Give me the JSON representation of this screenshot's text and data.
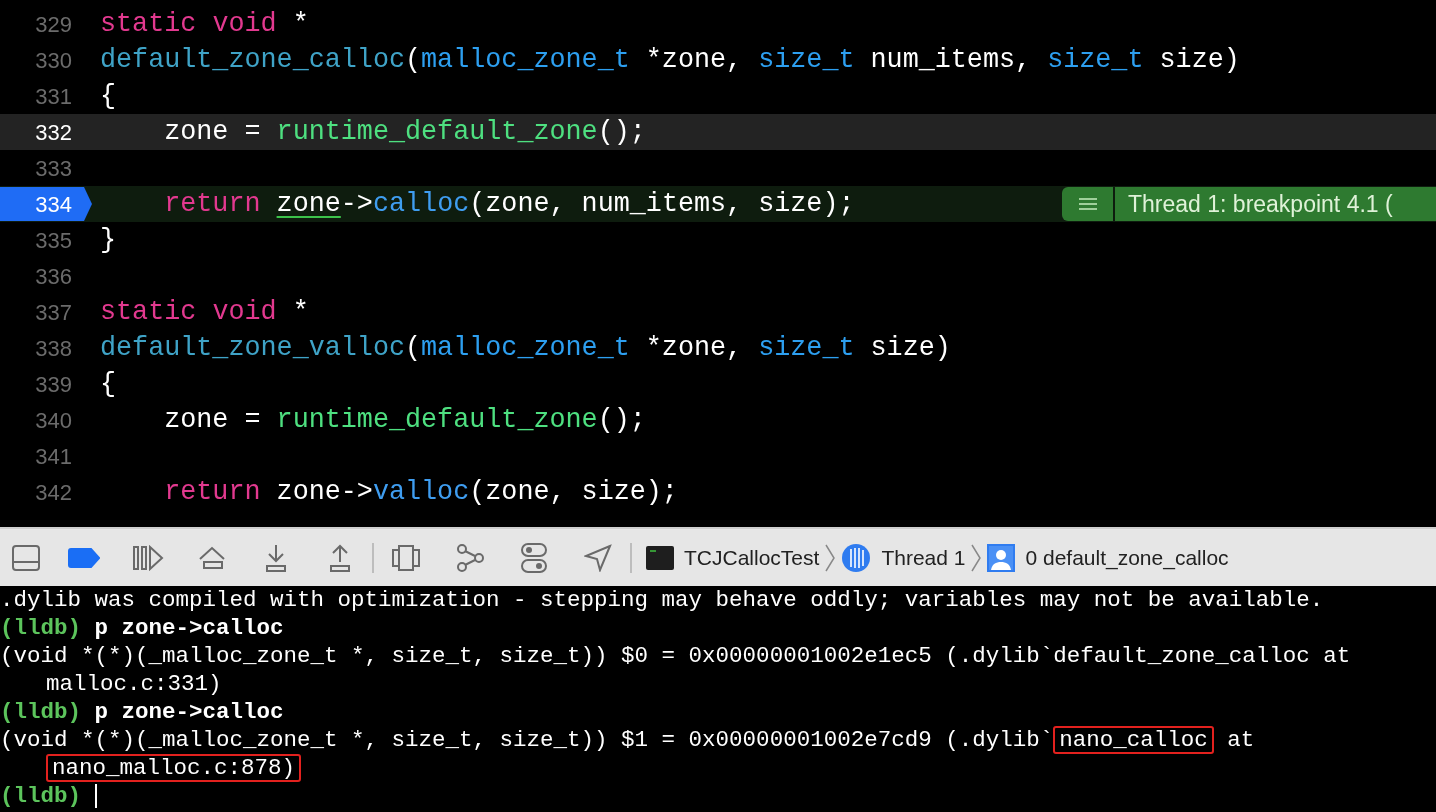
{
  "editor": {
    "lines": [
      {
        "number": "329",
        "current": false,
        "breakpoint": false,
        "tokens": [
          {
            "kind": "keyword",
            "text": "static"
          },
          {
            "kind": "keyword",
            "text": " void"
          },
          {
            "kind": "plain",
            "text": " *"
          }
        ]
      },
      {
        "number": "330",
        "current": false,
        "breakpoint": false,
        "tokens": [
          {
            "kind": "declaration",
            "text": "default_zone_calloc"
          },
          {
            "kind": "plain",
            "text": "("
          },
          {
            "kind": "type",
            "text": "malloc_zone_t"
          },
          {
            "kind": "plain",
            "text": " *zone, "
          },
          {
            "kind": "type",
            "text": "size_t"
          },
          {
            "kind": "plain",
            "text": " num_items, "
          },
          {
            "kind": "type",
            "text": "size_t"
          },
          {
            "kind": "plain",
            "text": " size)"
          }
        ]
      },
      {
        "number": "331",
        "current": false,
        "breakpoint": false,
        "tokens": [
          {
            "kind": "plain",
            "text": "{"
          }
        ]
      },
      {
        "number": "332",
        "current": true,
        "breakpoint": false,
        "tokens": [
          {
            "kind": "plain",
            "text": "    zone = "
          },
          {
            "kind": "call",
            "text": "runtime_default_zone"
          },
          {
            "kind": "plain",
            "text": "();"
          }
        ]
      },
      {
        "number": "333",
        "current": false,
        "breakpoint": false
      },
      {
        "number": "334",
        "current": false,
        "breakpoint": true,
        "tokens": [
          {
            "kind": "keyword",
            "text": "    return "
          },
          {
            "kind": "flagged",
            "text": "zone"
          },
          {
            "kind": "plain",
            "text": "->"
          },
          {
            "kind": "member",
            "text": "calloc"
          },
          {
            "kind": "plain",
            "text": "(zone, num_items, size);"
          }
        ],
        "annotation": "Thread 1: breakpoint 4.1 ("
      },
      {
        "number": "335",
        "current": false,
        "breakpoint": false,
        "tokens": [
          {
            "kind": "plain",
            "text": "}"
          }
        ]
      },
      {
        "number": "336",
        "current": false,
        "breakpoint": false
      },
      {
        "number": "337",
        "current": false,
        "breakpoint": false,
        "tokens": [
          {
            "kind": "keyword",
            "text": "static"
          },
          {
            "kind": "keyword",
            "text": " void"
          },
          {
            "kind": "plain",
            "text": " *"
          }
        ]
      },
      {
        "number": "338",
        "current": false,
        "breakpoint": false,
        "tokens": [
          {
            "kind": "declaration",
            "text": "default_zone_valloc"
          },
          {
            "kind": "plain",
            "text": "("
          },
          {
            "kind": "type",
            "text": "malloc_zone_t"
          },
          {
            "kind": "plain",
            "text": " *zone, "
          },
          {
            "kind": "type",
            "text": "size_t"
          },
          {
            "kind": "plain",
            "text": " size)"
          }
        ]
      },
      {
        "number": "339",
        "current": false,
        "breakpoint": false,
        "tokens": [
          {
            "kind": "plain",
            "text": "{"
          }
        ]
      },
      {
        "number": "340",
        "current": false,
        "breakpoint": false,
        "tokens": [
          {
            "kind": "plain",
            "text": "    zone = "
          },
          {
            "kind": "call",
            "text": "runtime_default_zone"
          },
          {
            "kind": "plain",
            "text": "();"
          }
        ]
      },
      {
        "number": "341",
        "current": false,
        "breakpoint": false
      },
      {
        "number": "342",
        "current": false,
        "breakpoint": false,
        "tokens": [
          {
            "kind": "keyword",
            "text": "    return"
          },
          {
            "kind": "plain",
            "text": " zone->"
          },
          {
            "kind": "member",
            "text": "valloc"
          },
          {
            "kind": "plain",
            "text": "(zone, size);"
          }
        ]
      }
    ]
  },
  "debug_bar": {
    "breakpoints_active": true,
    "path": [
      {
        "kind": "process",
        "text": "TCJCallocTest"
      },
      {
        "kind": "thread",
        "text": "Thread 1"
      },
      {
        "kind": "frame",
        "text": "0 default_zone_calloc"
      }
    ]
  },
  "console": {
    "lines": [
      {
        "kind": "output",
        "continuation": false,
        "segments": [
          {
            "text": ".dylib was compiled with optimization - stepping may behave oddly; variables may not be available.",
            "boxed": false
          }
        ]
      },
      {
        "kind": "command",
        "prompt": "(lldb)",
        "command": "p zone->calloc"
      },
      {
        "kind": "output",
        "continuation": false,
        "segments": [
          {
            "text": "(void *(*)(_malloc_zone_t *, size_t, size_t)) $0 = 0x00000001002e1ec5 (.dylib`default_zone_calloc at",
            "boxed": false
          }
        ]
      },
      {
        "kind": "output",
        "continuation": true,
        "segments": [
          {
            "text": "malloc.c:331)",
            "boxed": false
          }
        ]
      },
      {
        "kind": "command",
        "prompt": "(lldb)",
        "command": "p zone->calloc"
      },
      {
        "kind": "output",
        "continuation": false,
        "segments": [
          {
            "text": "(void *(*)(_malloc_zone_t *, size_t, size_t)) $1 = 0x00000001002e7cd9 (.dylib`",
            "boxed": false
          },
          {
            "text": "nano_calloc",
            "boxed": true
          },
          {
            "text": " at",
            "boxed": false
          }
        ]
      },
      {
        "kind": "output",
        "continuation": true,
        "segments": [
          {
            "text": "nano_malloc.c:878)",
            "boxed": true
          }
        ]
      },
      {
        "kind": "input",
        "prompt": "(lldb)"
      }
    ]
  }
}
